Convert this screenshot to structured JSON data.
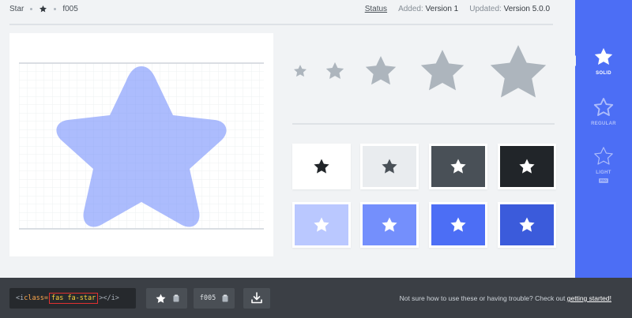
{
  "breadcrumb": {
    "name": "Star",
    "icon": "star-icon",
    "unicode": "f005"
  },
  "meta": {
    "status_label": "Status",
    "added_label": "Added:",
    "added_value": "Version 1",
    "updated_label": "Updated:",
    "updated_value": "Version 5.0.0"
  },
  "sidebar": {
    "accent": "#4c6ef5",
    "styles": [
      {
        "label": "SOLID",
        "icon": "star-solid-icon",
        "selected": true
      },
      {
        "label": "REGULAR",
        "icon": "star-regular-icon",
        "selected": false
      },
      {
        "label": "LIGHT",
        "icon": "star-light-icon",
        "selected": false,
        "badge": "PRO"
      }
    ]
  },
  "swatches": [
    {
      "bg": "#ffffff",
      "fg": "#212529"
    },
    {
      "bg": "#e9ecef",
      "fg": "#495057"
    },
    {
      "bg": "#495057",
      "fg": "#ffffff"
    },
    {
      "bg": "#212529",
      "fg": "#ffffff"
    },
    {
      "bg": "#bac8ff",
      "fg": "#ffffff"
    },
    {
      "bg": "#748ffc",
      "fg": "#ffffff"
    },
    {
      "bg": "#4c6ef5",
      "fg": "#ffffff"
    },
    {
      "bg": "#3b5bdb",
      "fg": "#ffffff"
    }
  ],
  "bottom": {
    "code_open": "<i ",
    "code_attr": "class=",
    "code_class": "fas fa-star",
    "code_close": "></i>",
    "unicode_label": "f005",
    "help_text": "Not sure how to use these or having trouble? Check out",
    "help_link": "getting started!",
    "copy_icon": "clipboard-icon",
    "download_icon": "download-icon"
  }
}
